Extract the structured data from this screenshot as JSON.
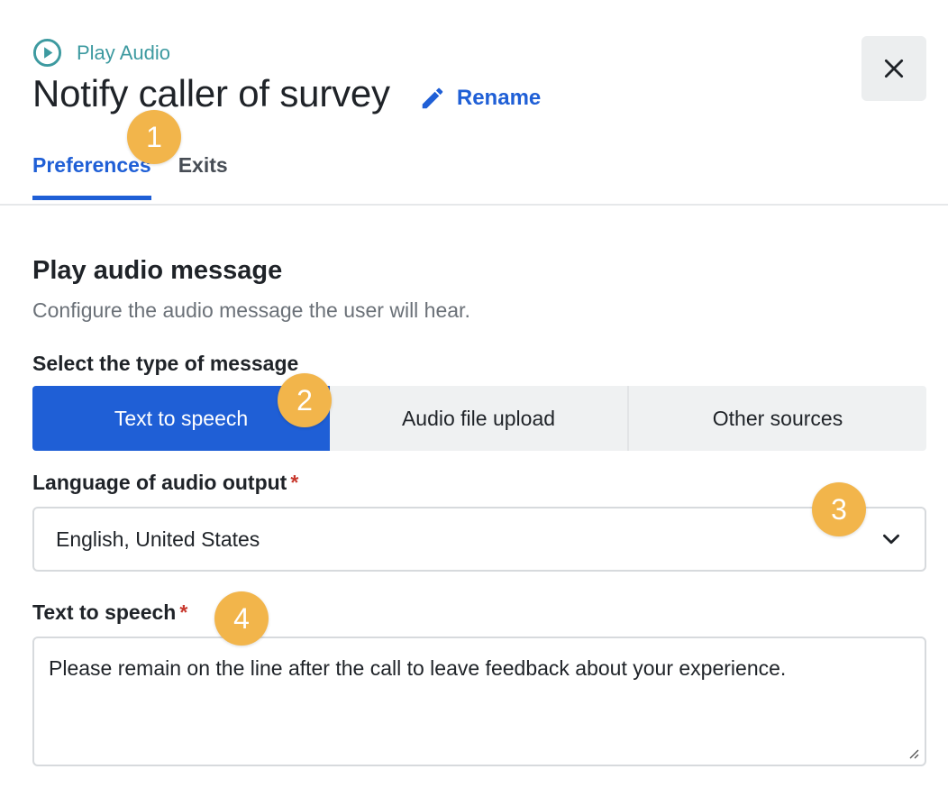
{
  "header": {
    "type_label": "Play Audio",
    "title": "Notify caller of survey",
    "rename_label": "Rename",
    "close_icon": "close-icon"
  },
  "tabs": [
    {
      "label": "Preferences",
      "active": true
    },
    {
      "label": "Exits",
      "active": false
    }
  ],
  "section": {
    "title": "Play audio message",
    "description": "Configure the audio message the user will hear."
  },
  "message_type": {
    "label": "Select the type of message",
    "options": [
      "Text to speech",
      "Audio file upload",
      "Other sources"
    ],
    "selected": "Text to speech"
  },
  "language": {
    "label": "Language of audio output",
    "required_mark": "*",
    "value": "English, United States"
  },
  "tts": {
    "label": "Text to speech",
    "required_mark": "*",
    "value": "Please remain on the line after the call to leave feedback about your experience."
  },
  "callouts": [
    "1",
    "2",
    "3",
    "4"
  ],
  "colors": {
    "accent": "#1f5fd6",
    "play_audio_teal": "#3d9aa0",
    "required": "#c8392e",
    "callout": "#f2b54b"
  }
}
